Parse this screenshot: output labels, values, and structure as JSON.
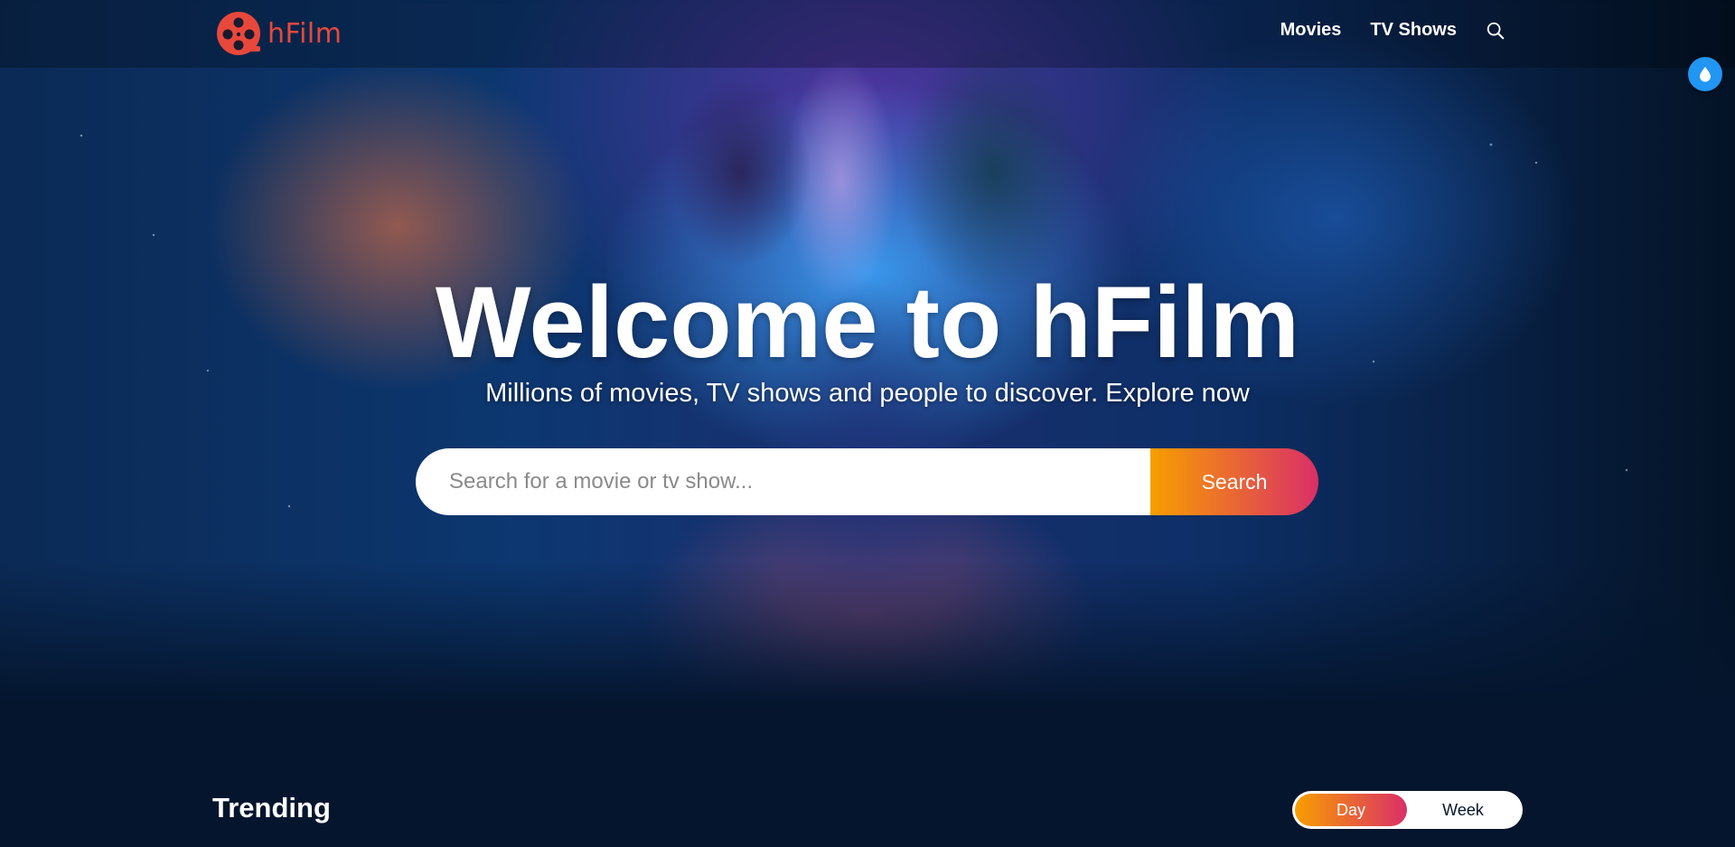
{
  "header": {
    "logo_text": "hFilm",
    "nav": [
      {
        "label": "Movies"
      },
      {
        "label": "TV Shows"
      }
    ],
    "search_icon": "search-icon",
    "floating_button_icon": "water-drop-icon"
  },
  "hero": {
    "title": "Welcome to hFilm",
    "subtitle": "Millions of movies, TV shows and people to discover. Explore now",
    "search_placeholder": "Search for a movie or tv show...",
    "search_button": "Search"
  },
  "trending": {
    "title": "Trending",
    "tabs": [
      "Day",
      "Week"
    ],
    "active_tab": "Day"
  },
  "colors": {
    "background": "#04152d",
    "logo": "#e8483b",
    "gradient_start": "#f89e00",
    "gradient_end": "#da2f68",
    "fab": "#2196f3"
  }
}
